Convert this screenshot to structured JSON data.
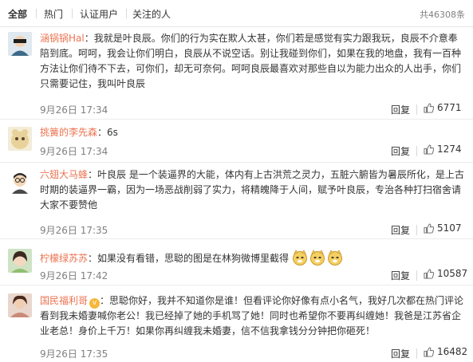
{
  "tabs": [
    {
      "label": "全部"
    },
    {
      "label": "热门"
    },
    {
      "label": "认证用户"
    },
    {
      "label": "关注的人"
    }
  ],
  "total_label": "共46308条",
  "colors": {
    "username": "#eb7350",
    "meta": "#808080",
    "text": "#333333"
  },
  "comments": [
    {
      "username": "涵锅锅Hal",
      "text": "：我就是叶良辰。你们的行为实在欺人太甚，你们若是感觉有实力跟我玩，良辰不介意奉陪到底。呵呵，我会让你们明白，良辰从不说空话。别让我碰到你们，如果在我的地盘，我有一百种方法让你们待不下去，可你们，却无可奈何。呵呵良辰最喜欢对那些自以为能力出众的人出手，你们只需要记住，我叫叶良辰",
      "time": "9月26日 17:34",
      "reply": "回复",
      "likes": "6771"
    },
    {
      "username": "挑簧的李先森",
      "text": "：6s",
      "time": "9月26日 17:34",
      "reply": "回复",
      "likes": "1274"
    },
    {
      "username": "六翅大马蜂",
      "text": "：叶良辰 是一个装逼界的大能，体内有上古洪荒之灵力，五脏六腑皆为暑辰所化，是上古时期的装逼界一霸，因为一场恶战削弱了实力，将精魄降于人间，赋予叶良辰，专治各种打扫宿舍请大家不要赞他",
      "time": "9月26日 17:35",
      "reply": "回复",
      "likes": "5107"
    },
    {
      "username": "柠檬绿苏苏",
      "text": "：如果没有看错，思聪的图是在林狗微博里截得",
      "time": "9月26日 17:42",
      "reply": "回复",
      "likes": "10587"
    },
    {
      "username": "国民福利哥",
      "text": "：思聪你好，我并不知道你是谁！但看评论你好像有点小名气，我好几次都在热门评论看到我未婚妻喊你老公！我已经掉了她的手机骂了她！同时也希望你不要再纠缠她！我爸是江苏省企业老总！身价上千万！如果你再纠缠我未婚妻，信不信我拿钱分分钟把你砸死！",
      "time": "9月26日 17:35",
      "reply": "回复",
      "likes": "16482"
    }
  ]
}
